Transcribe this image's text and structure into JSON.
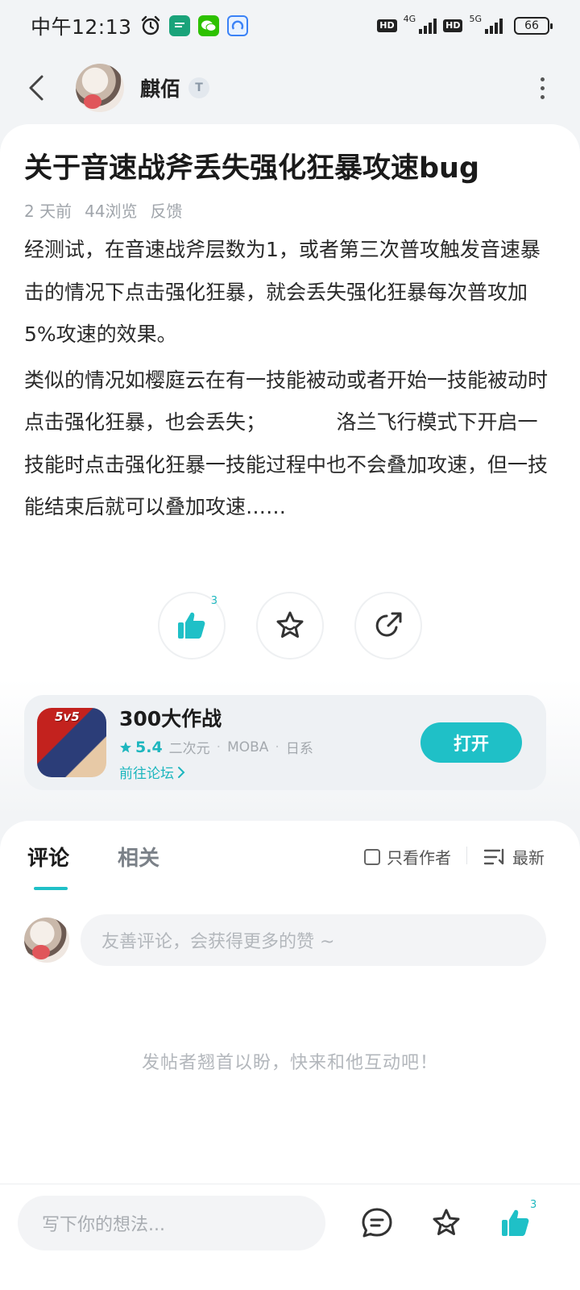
{
  "status_bar": {
    "time": "中午12:13",
    "net_1": "4G",
    "net_2": "5G",
    "hd": "HD",
    "battery": "66"
  },
  "header": {
    "author_name": "麒佰",
    "level_badge": "T"
  },
  "post": {
    "title": "关于音速战斧丢失强化狂暴攻速bug",
    "time_ago": "2 天前",
    "views": "44浏览",
    "category": "反馈",
    "paragraphs": [
      "经测试，在音速战斧层数为1，或者第三次普攻触发音速暴击的情况下点击强化狂暴，就会丢失强化狂暴每次普攻加5%攻速的效果。",
      "类似的情况如樱庭云在有一技能被动或者开始一技能被动时点击强化狂暴，也会丢失；　　　　洛兰飞行模式下开启一技能时点击强化狂暴一技能过程中也不会叠加攻速，但一技能结束后就可以叠加攻速……"
    ],
    "like_count": "3"
  },
  "game_card": {
    "icon_text": "5v5",
    "name": "300大作战",
    "rating": "5.4",
    "tags": [
      "二次元",
      "MOBA",
      "日系"
    ],
    "forum_link": "前往论坛",
    "open_label": "打开"
  },
  "comments": {
    "tab_comments": "评论",
    "tab_related": "相关",
    "author_only": "只看作者",
    "sort_label": "最新",
    "input_placeholder": "友善评论，会获得更多的赞 ~",
    "empty_hint": "发帖者翘首以盼，快来和他互动吧！"
  },
  "bottom_bar": {
    "input_placeholder": "写下你的想法...",
    "like_count": "3"
  },
  "colors": {
    "accent": "#1fc0c7",
    "background": "#f2f4f6"
  }
}
